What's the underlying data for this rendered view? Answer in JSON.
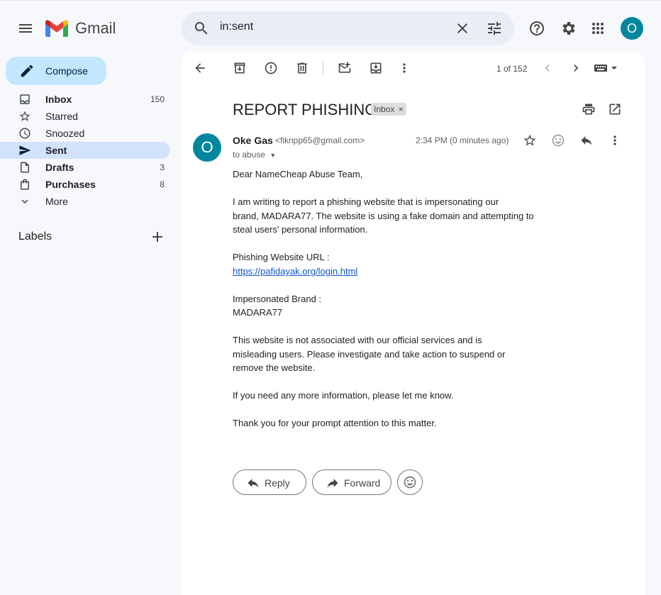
{
  "app": {
    "logo_text": "Gmail"
  },
  "search": {
    "value": "in:sent"
  },
  "account": {
    "initial": "O",
    "color": "#00879e"
  },
  "compose": {
    "label": "Compose"
  },
  "nav": [
    {
      "label": "Inbox",
      "count": "150",
      "bold": true
    },
    {
      "label": "Starred",
      "count": "",
      "bold": false
    },
    {
      "label": "Snoozed",
      "count": "",
      "bold": false
    },
    {
      "label": "Sent",
      "count": "",
      "bold": true,
      "active": true
    },
    {
      "label": "Drafts",
      "count": "3",
      "bold": true
    },
    {
      "label": "Purchases",
      "count": "8",
      "bold": true
    },
    {
      "label": "More",
      "count": "",
      "bold": false
    }
  ],
  "labels": {
    "title": "Labels"
  },
  "toolbar": {
    "pager": "1 of 152"
  },
  "email": {
    "subject": "REPORT PHISHING",
    "chip": "Inbox",
    "sender_initial": "O",
    "sender_name": "Oke Gas",
    "sender_email": "<fikripp65@gmail.com>",
    "to": "to abuse",
    "time": "2:34 PM (0 minutes ago)",
    "body": [
      "Dear NameCheap Abuse Team,",
      "I am writing to report a phishing website that is impersonating our",
      "brand, MADARA77. The website is using a fake domain and attempting to",
      "steal users' personal information.",
      "Phishing Website URL :",
      "https://pafidayak.org/login.html",
      "Impersonated Brand :",
      "MADARA77",
      "This website is not associated with our official services and is",
      "misleading users. Please investigate and take action to suspend or",
      "remove the website.",
      "If you need any more information, please let me know.",
      "Thank you for your prompt attention to this matter."
    ]
  },
  "actions": {
    "reply": "Reply",
    "forward": "Forward"
  },
  "colors": {
    "accent": "#c2e7ff",
    "active_nav": "#d3e3fd",
    "link": "#1155cc"
  }
}
